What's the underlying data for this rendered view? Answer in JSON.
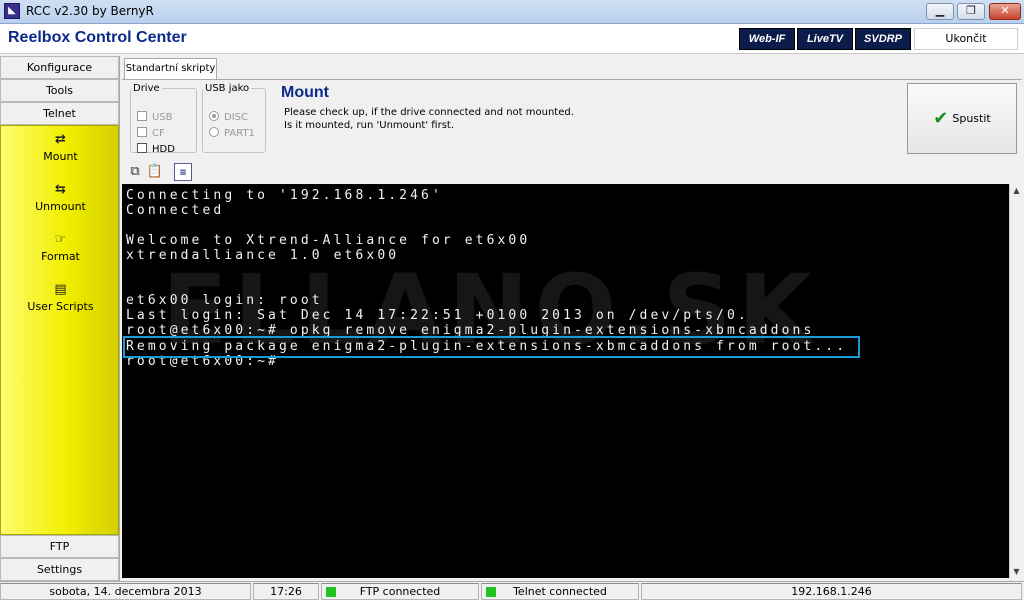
{
  "window": {
    "title": "RCC v2.30 by BernyR",
    "minimize": "0",
    "maximize": "1",
    "close": "r"
  },
  "header": {
    "title": "Reelbox Control Center",
    "buttons": {
      "webif": "Web-IF",
      "livetv": "LiveTV",
      "svdrp": "SVDRP"
    },
    "quit": "Ukončit"
  },
  "nav": {
    "konfigurace": "Konfigurace",
    "tools": "Tools",
    "telnet": "Telnet",
    "ftp": "FTP",
    "settings": "Settings",
    "tools_panel": {
      "mount": "Mount",
      "unmount": "Unmount",
      "format": "Format",
      "user_scripts": "User Scripts"
    }
  },
  "tabs": {
    "active": "Standartní skripty"
  },
  "drive": {
    "legend": "Drive",
    "options": {
      "usb": "USB",
      "cf": "CF",
      "hdd": "HDD"
    }
  },
  "usb_jako": {
    "legend": "USB jako",
    "options": {
      "disc": "DISC",
      "part1": "PART1"
    }
  },
  "mount": {
    "title": "Mount",
    "desc1": "Please check up, if the drive connected and not mounted.",
    "desc2": "Is it mounted, run 'Unmount' first.",
    "run_button": "Spustit"
  },
  "toolbar_icons": {
    "copy": "copy-icon",
    "paste": "paste-icon",
    "script": "script-icon"
  },
  "terminal": {
    "watermark": "ELLANO.SK",
    "lines": [
      "Connecting to '192.168.1.246'",
      "Connected",
      "",
      "Welcome to Xtrend-Alliance for et6x00",
      "xtrendalliance 1.0 et6x00",
      "",
      "",
      "et6x00 login: root",
      "Last login: Sat Dec 14 17:22:51 +0100 2013 on /dev/pts/0.",
      "root@et6x00:~# opkg remove enigma2-plugin-extensions-xbmcaddons",
      "Removing package enigma2-plugin-extensions-xbmcaddons from root...",
      "root@et6x00:~#"
    ]
  },
  "status": {
    "date": "sobota, 14. decembra 2013",
    "time": "17:26",
    "ftp": "FTP connected",
    "telnet": "Telnet connected",
    "ip": "192.168.1.246"
  },
  "colors": {
    "accent": "#0c2a8a",
    "highlight": "#1a9ad6",
    "led": "#22c022",
    "nav_yellow": "#f2ef00"
  }
}
